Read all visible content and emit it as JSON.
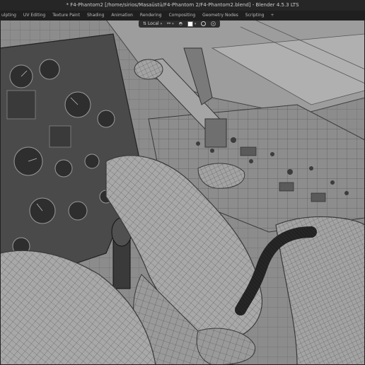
{
  "window": {
    "title": "* F4-Phantom2 [/home/sirios/Masaüstü/F4-Phantom 2/F4-Phantom2.blend] - Blender 4.5.3 LTS"
  },
  "workspaces": {
    "tabs": [
      {
        "label": "ulpting"
      },
      {
        "label": "UV Editing"
      },
      {
        "label": "Texture Paint"
      },
      {
        "label": "Shading"
      },
      {
        "label": "Animation"
      },
      {
        "label": "Rendering"
      },
      {
        "label": "Compositing"
      },
      {
        "label": "Geometry Nodes"
      },
      {
        "label": "Scripting"
      }
    ],
    "add_label": "+"
  },
  "viewport_header": {
    "transform_orientation": "Local",
    "orientation_icon": "axis-local-icon",
    "snap_icon": "magnet-icon",
    "proportional_icon": "link-icon",
    "color_swatch": "#ffffff",
    "overlay_icon": "circle-outline-icon",
    "shading_icon": "circle-dot-icon"
  },
  "scene": {
    "description_colors": {
      "mesh_base": "#8f8f8f",
      "wire": "#3c3c3c",
      "dark_panel": "#4a4a4a",
      "hose": "#2a2a2a"
    }
  }
}
